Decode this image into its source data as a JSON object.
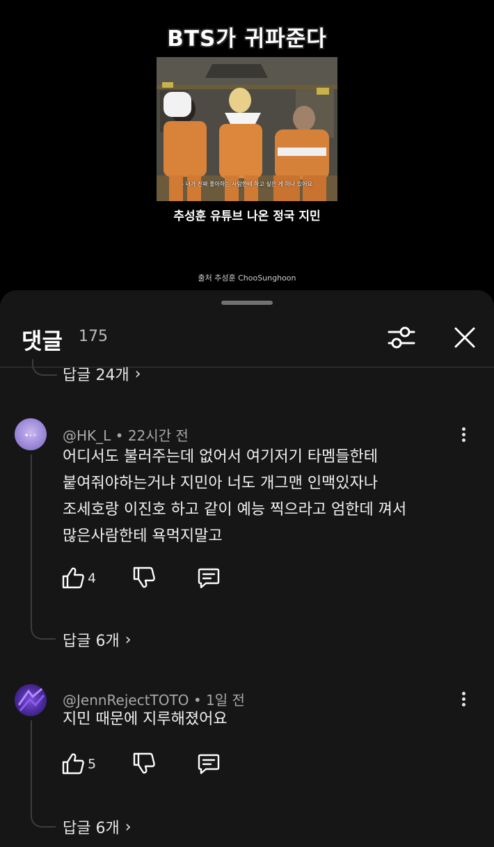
{
  "video": {
    "title": "BTS가 귀파준다",
    "thumbnail_subtitle": "- 너가 진짜 좋아하는 사람한테 하고 싶은 게 하나 있어요",
    "caption": "추성훈 유튜브 나온 정국 지민",
    "source": "출처 추성훈 ChooSunghoon"
  },
  "comments_header": {
    "title": "댓글",
    "count": "175",
    "filter_icon": "sliders-icon",
    "close_icon": "close-icon"
  },
  "previous_thread": {
    "replies_label": "답글 24개"
  },
  "comments": [
    {
      "author": "@HK_L",
      "time": "22시간 전",
      "lines": [
        "어디서도 불러주는데 없어서 여기저기 타멤들한테",
        "붙여줘야하는거냐 지민아 너도 개그맨 인맥있자나",
        "조세호랑 이진호 하고 같이 예능 찍으라고 엄한데 껴서",
        "많은사람한테 욕먹지말고"
      ],
      "likes": "4",
      "replies_label": "답글 6개"
    },
    {
      "author": "@JennRejectTOTO",
      "time": "1일 전",
      "lines": [
        "지민 때문에 지루해졌어요"
      ],
      "likes": "5",
      "replies_label": "답글 6개"
    }
  ],
  "colors": {
    "background": "#000000",
    "sheet": "#161616",
    "text": "#f2f2f2",
    "meta": "#a9a9a9"
  }
}
